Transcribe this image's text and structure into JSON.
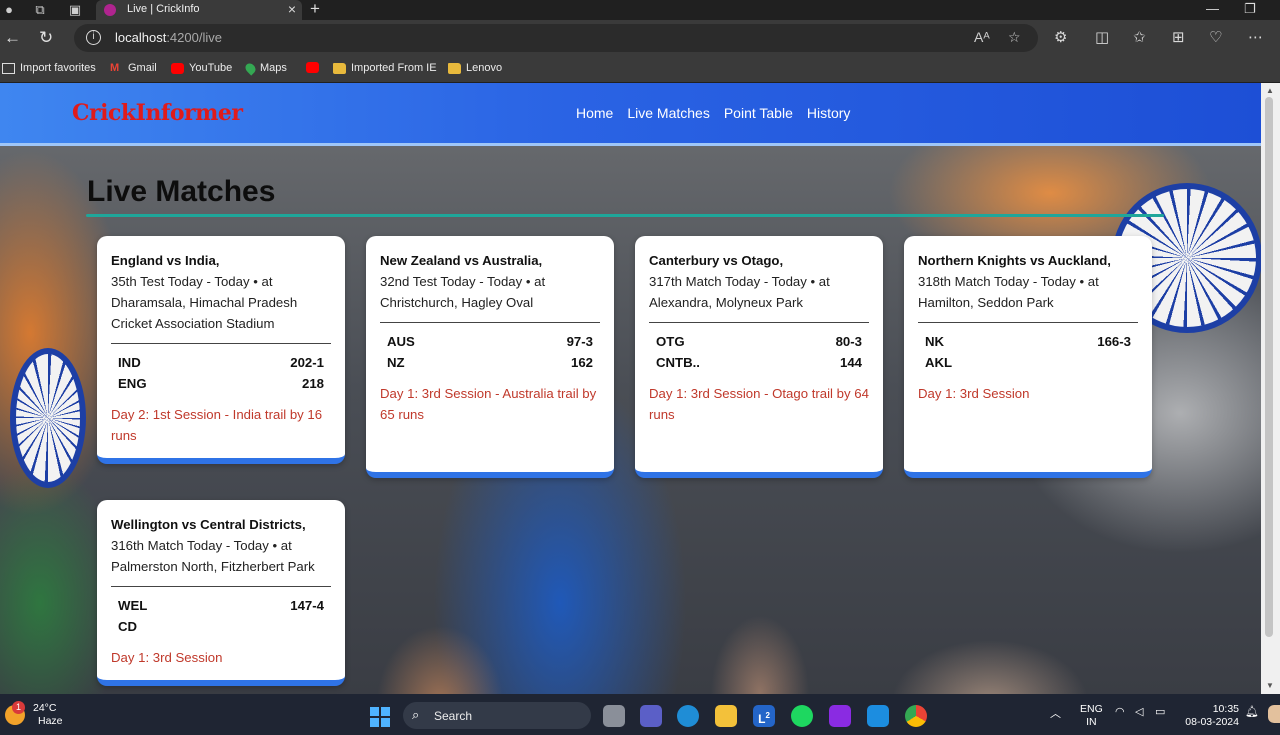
{
  "browser": {
    "tab_title": "Live | CrickInfo",
    "url_host": "localhost",
    "url_rest": ":4200/live",
    "bookmarks": [
      {
        "label": "Import favorites"
      },
      {
        "label": "Gmail"
      },
      {
        "label": "YouTube"
      },
      {
        "label": "Maps"
      },
      {
        "label": ""
      },
      {
        "label": "Imported From IE"
      },
      {
        "label": "Lenovo"
      }
    ]
  },
  "site": {
    "brand": "CrickInformer",
    "nav": [
      "Home",
      "Live Matches",
      "Point Table",
      "History"
    ]
  },
  "page": {
    "heading": "Live Matches"
  },
  "matches": [
    {
      "title": "England vs India,",
      "desc": "35th Test Today - Today • at Dharamsala, Himachal Pradesh Cricket Association Stadium",
      "teams": [
        {
          "name": "IND",
          "score": "202-1"
        },
        {
          "name": "ENG",
          "score": "218"
        }
      ],
      "status": "Day 2: 1st Session - India trail by 16 runs"
    },
    {
      "title": "New Zealand vs Australia,",
      "desc": "32nd Test Today - Today • at Christchurch, Hagley Oval",
      "teams": [
        {
          "name": "AUS",
          "score": "97-3"
        },
        {
          "name": "NZ",
          "score": "162"
        }
      ],
      "status": "Day 1: 3rd Session - Australia trail by 65 runs"
    },
    {
      "title": "Canterbury vs Otago,",
      "desc": "317th Match Today - Today • at Alexandra, Molyneux Park",
      "teams": [
        {
          "name": "OTG",
          "score": "80-3"
        },
        {
          "name": "CNTB..",
          "score": "144"
        }
      ],
      "status": "Day 1: 3rd Session - Otago trail by 64 runs"
    },
    {
      "title": "Northern Knights vs Auckland,",
      "desc": "318th Match Today - Today • at Hamilton, Seddon Park",
      "teams": [
        {
          "name": "NK",
          "score": "166-3"
        },
        {
          "name": "AKL",
          "score": ""
        }
      ],
      "status": "Day 1: 3rd Session"
    },
    {
      "title": "Wellington vs Central Districts,",
      "desc": "316th Match Today - Today • at Palmerston North, Fitzherbert Park",
      "teams": [
        {
          "name": "WEL",
          "score": "147-4"
        },
        {
          "name": "CD",
          "score": ""
        }
      ],
      "status": "Day 1: 3rd Session"
    }
  ],
  "taskbar": {
    "weather_temp": "24°C",
    "weather_desc": "Haze",
    "weather_badge": "1",
    "search_label": "Search",
    "lang_top": "ENG",
    "lang_bottom": "IN",
    "time": "10:35",
    "date": "08-03-2024",
    "outlook_badge": "2"
  }
}
